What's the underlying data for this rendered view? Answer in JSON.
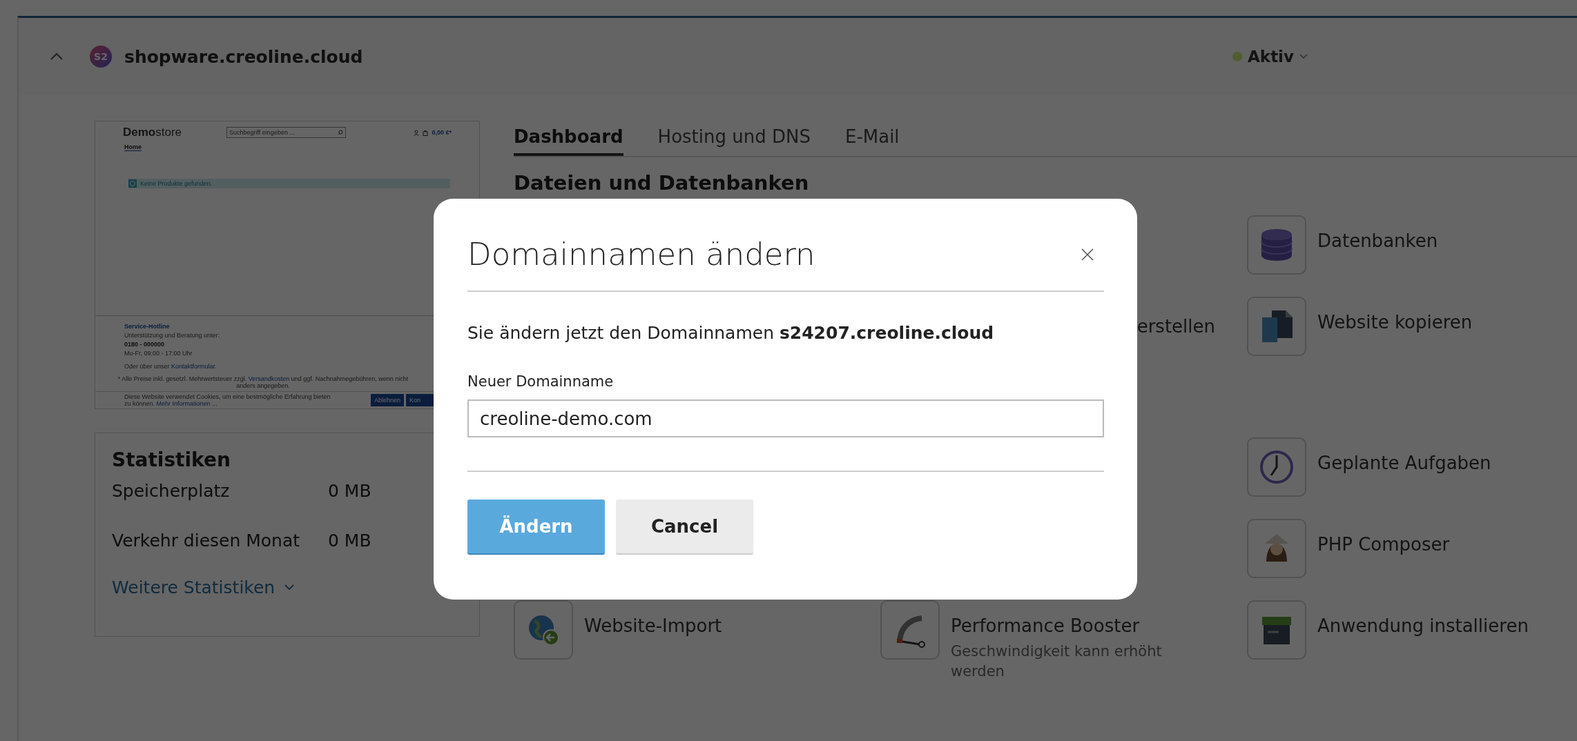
{
  "site": {
    "title": "shopware.creoline.cloud",
    "logo_text": "S2",
    "expanded": true,
    "status": {
      "label": "Aktiv",
      "color": "#4f5d30"
    }
  },
  "preview": {
    "logo": "**Demo**store",
    "search_placeholder": "Suchbegriff eingeben ...",
    "cart": "0,00 €*",
    "nav": "Home",
    "notice": "Keine Produkte gefunden.",
    "hotline_title": "Service-Hotline",
    "hotline_text": "Unterstützung und Beratung unter:",
    "hotline_phone": "0180 - 000000",
    "hotline_hours": "Mo-Fr, 09:00 - 17:00 Uhr",
    "contact": {
      "text": "Oder über unser",
      "link": "Kontaktformular",
      "after": "."
    },
    "price_note": {
      "text": "* Alle Preise inkl. gesetzl. Mehrwertsteuer zzgl.",
      "link": "Versandkosten",
      "after": "und ggf. Nachnahmegebühren, wenn nicht anders angegeben."
    },
    "cookie": {
      "text": "Diese Website verwendet Cookies, um eine bestmögliche Erfahrung bieten zu können.",
      "link": "Mehr Informationen ..."
    },
    "cookie_buttons": [
      "Ablehnen",
      "Kon"
    ]
  },
  "statistics": {
    "title": "Statistiken",
    "rows": [
      {
        "label": "Speicherplatz",
        "value": "0 MB"
      },
      {
        "label": "Verkehr diesen Monat",
        "value": "0 MB"
      }
    ],
    "more": "Weitere Statistiken"
  },
  "tabs": [
    {
      "label": "Dashboard",
      "selected": true
    },
    {
      "label": "Hosting und DNS",
      "selected": false
    },
    {
      "label": "E-Mail",
      "selected": false
    }
  ],
  "sections": [
    {
      "heading": "Dateien und Datenbanken",
      "items": [
        {
          "label": "Datenbanken",
          "kind": "database"
        },
        {
          "label": "erstellen",
          "kind": "text"
        },
        {
          "label": "Website kopieren",
          "kind": "copy"
        }
      ]
    },
    {
      "items": [
        {
          "label": "Geplante Aufgaben",
          "kind": "clock"
        },
        {
          "label": "PHP Composer",
          "kind": "composer"
        },
        {
          "label": "Website-Import",
          "kind": "globe"
        },
        {
          "label": "Performance Booster",
          "description": "Geschwindigkeit kann erhöht werden",
          "kind": "gauge"
        },
        {
          "label": "Anwendung installieren",
          "kind": "box"
        }
      ]
    }
  ],
  "dialog": {
    "title": "Domainnamen ändern",
    "message": "Sie ändern jetzt den Domainnamen **s24207.creoline.cloud**",
    "field_label": "Neuer Domainname",
    "field_value": "creoline-demo.com",
    "buttons": [
      {
        "label": "Ändern",
        "kind": "primary"
      },
      {
        "label": "Cancel",
        "kind": "secondary"
      }
    ]
  }
}
